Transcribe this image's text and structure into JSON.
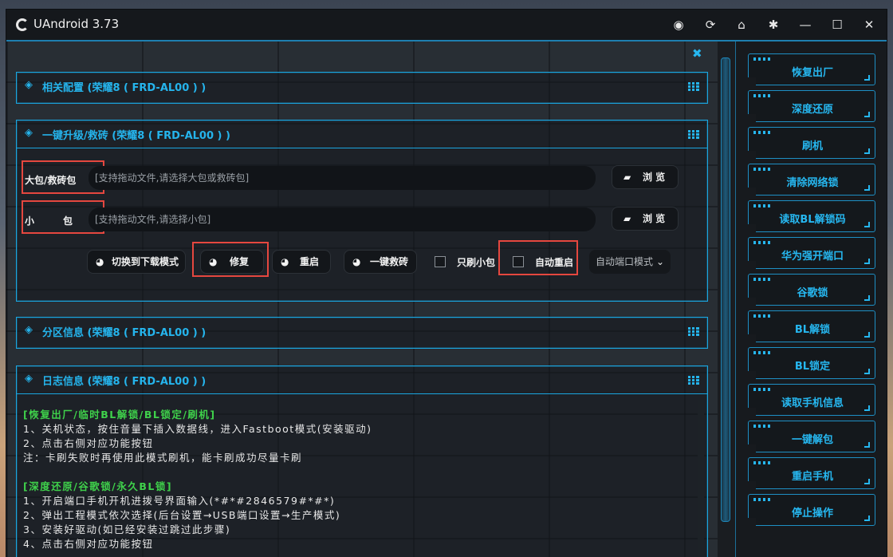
{
  "window": {
    "title": "UAndroid 3.73",
    "controls": [
      "globe-icon",
      "refresh-icon",
      "home-icon",
      "gear-icon",
      "minimize-icon",
      "maximize-icon",
      "close-icon"
    ]
  },
  "panels": {
    "config": {
      "title": "相关配置 (荣耀8 ( FRD-AL00 ) )"
    },
    "upgrade": {
      "title": "一键升级/救砖 (荣耀8 ( FRD-AL00 ) )",
      "big_package_label": "大包/救砖包",
      "big_package_placeholder": "[支持拖动文件,请选择大包或救砖包]",
      "small_package_label": "小　　　包",
      "small_package_placeholder": "[支持拖动文件,请选择小包]",
      "browse_label": "浏 览",
      "buttons": {
        "switch_download": "切换到下载模式",
        "repair": "修复",
        "reboot": "重启",
        "one_click_rescue": "一键救砖"
      },
      "checkboxes": {
        "only_small": "只刷小包",
        "auto_reboot": "自动重启"
      },
      "port_mode": "自动端口模式"
    },
    "partition": {
      "title": "分区信息 (荣耀8 ( FRD-AL00 ) )"
    },
    "log": {
      "title": "日志信息 (荣耀8 ( FRD-AL00 ) )",
      "lines": [
        {
          "text": "[恢复出厂/临时BL解锁/BL锁定/刷机]",
          "heading": true
        },
        {
          "text": "1、关机状态，按住音量下插入数据线，进入Fastboot模式(安装驱动)",
          "heading": false
        },
        {
          "text": "2、点击右侧对应功能按钮",
          "heading": false
        },
        {
          "text": "注：卡刷失败时再使用此模式刷机，能卡刷成功尽量卡刷",
          "heading": false
        },
        {
          "text": "",
          "heading": false
        },
        {
          "text": "[深度还原/谷歌锁/永久BL锁]",
          "heading": true
        },
        {
          "text": "1、开启端口手机开机进拨号界面输入(*#*#2846579#*#*)",
          "heading": false
        },
        {
          "text": "2、弹出工程模式依次选择(后台设置→USB端口设置→生产模式)",
          "heading": false
        },
        {
          "text": "3、安装好驱动(如已经安装过跳过此步骤)",
          "heading": false
        },
        {
          "text": "4、点击右侧对应功能按钮",
          "heading": false
        }
      ]
    }
  },
  "sidebar": {
    "items": [
      "恢复出厂",
      "深度还原",
      "刷机",
      "清除网络锁",
      "读取BL解锁码",
      "华为强开端口",
      "谷歌锁",
      "BL解锁",
      "BL锁定",
      "读取手机信息",
      "一键解包",
      "重启手机",
      "停止操作"
    ]
  },
  "colors": {
    "accent": "#26b7f0",
    "highlight": "#e5473f",
    "log_heading": "#3fd14b"
  }
}
